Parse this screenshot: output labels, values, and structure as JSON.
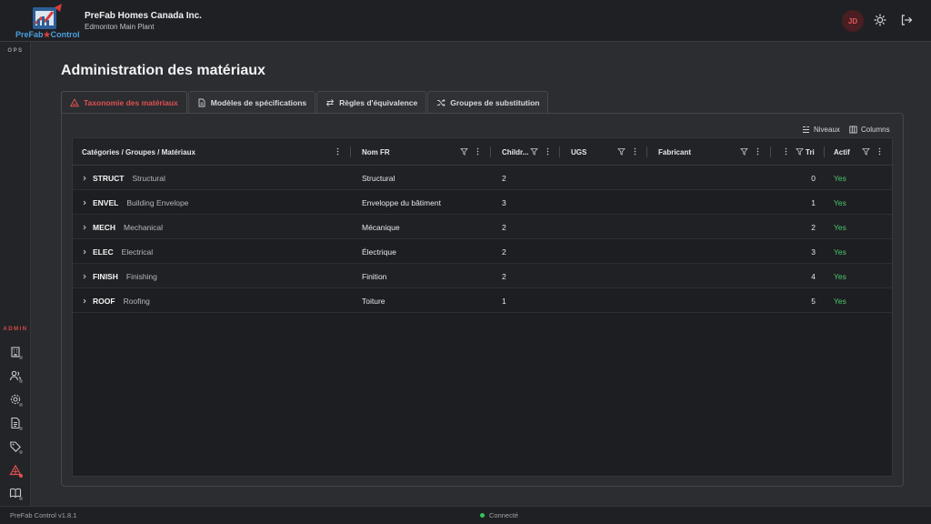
{
  "header": {
    "logo_text_left": "PreFab",
    "logo_text_star": "★",
    "logo_text_right": "Control",
    "company": "PreFab Homes Canada Inc.",
    "plant": "Edmonton Main Plant",
    "avatar_initials": "JD",
    "icons": [
      "theme-toggle-icon",
      "logout-icon"
    ]
  },
  "rail": {
    "ops_label": "OPS",
    "admin_label": "ADMIN",
    "admin_items": [
      "building-icon",
      "users-icon",
      "settings-icon",
      "document-icon",
      "tag-icon",
      "materials-icon",
      "book-icon"
    ],
    "active_item": "materials-icon"
  },
  "page": {
    "title": "Administration des matériaux"
  },
  "tabs": [
    {
      "label": "Taxonomie des matériaux",
      "icon": "materials-icon",
      "active": true
    },
    {
      "label": "Modèles de spécifications",
      "icon": "file-icon",
      "active": false
    },
    {
      "label": "Règles d'équivalence",
      "icon": "swap-icon",
      "active": false
    },
    {
      "label": "Groupes de substitution",
      "icon": "shuffle-icon",
      "active": false
    }
  ],
  "toolbar": {
    "levels_label": "Niveaux",
    "columns_label": "Columns"
  },
  "grid": {
    "columns": {
      "category": "Catégories / Groupes / Matériaux",
      "name_fr": "Nom FR",
      "children": "Childr...",
      "ugs": "UGS",
      "manufacturer": "Fabricant",
      "sort": "Tri",
      "active": "Actif"
    },
    "rows": [
      {
        "code": "STRUCT",
        "name": "Structural",
        "name_fr": "Structural",
        "children": "2",
        "ugs": "",
        "manufacturer": "",
        "sort": "0",
        "active": "Yes"
      },
      {
        "code": "ENVEL",
        "name": "Building Envelope",
        "name_fr": "Enveloppe du bâtiment",
        "children": "3",
        "ugs": "",
        "manufacturer": "",
        "sort": "1",
        "active": "Yes"
      },
      {
        "code": "MECH",
        "name": "Mechanical",
        "name_fr": "Mécanique",
        "children": "2",
        "ugs": "",
        "manufacturer": "",
        "sort": "2",
        "active": "Yes"
      },
      {
        "code": "ELEC",
        "name": "Electrical",
        "name_fr": "Électrique",
        "children": "2",
        "ugs": "",
        "manufacturer": "",
        "sort": "3",
        "active": "Yes"
      },
      {
        "code": "FINISH",
        "name": "Finishing",
        "name_fr": "Finition",
        "children": "2",
        "ugs": "",
        "manufacturer": "",
        "sort": "4",
        "active": "Yes"
      },
      {
        "code": "ROOF",
        "name": "Roofing",
        "name_fr": "Toiture",
        "children": "1",
        "ugs": "",
        "manufacturer": "",
        "sort": "5",
        "active": "Yes"
      }
    ]
  },
  "footer": {
    "version": "PreFab Control v1.8.1",
    "status": "Connecté"
  },
  "colors": {
    "accent": "#e05050",
    "success": "#4cc86a",
    "brand_blue": "#4a9fe0"
  }
}
